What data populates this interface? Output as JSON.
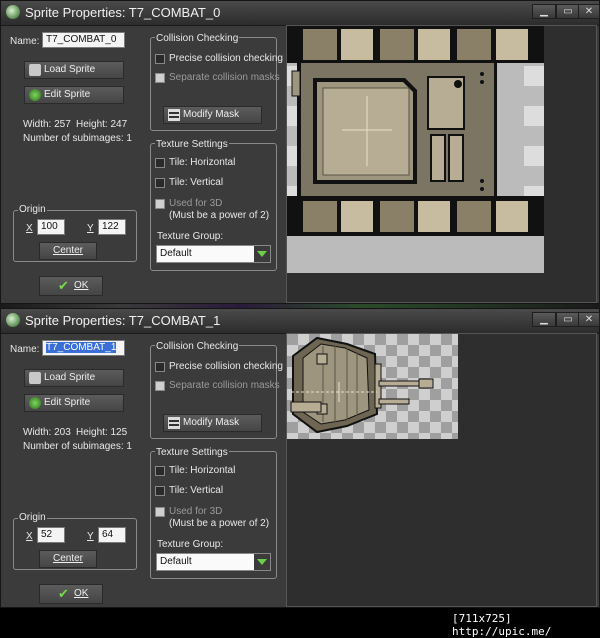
{
  "windows": [
    {
      "title": "Sprite Properties: T7_COMBAT_0",
      "name_label": "Name:",
      "name_value": "T7_COMBAT_0",
      "load_sprite": "Load Sprite",
      "edit_sprite": "Edit Sprite",
      "width_text": "Width: 257",
      "height_text": "Height: 247",
      "subimages_text": "Number of subimages: 1",
      "origin_label": "Origin",
      "x_label": "X",
      "x_value": "100",
      "y_label": "Y",
      "y_value": "122",
      "center": "Center",
      "ok": "OK",
      "collision_title": "Collision Checking",
      "precise": "Precise collision checking",
      "separate": "Separate collision masks",
      "modify_mask": "Modify Mask",
      "texture_title": "Texture Settings",
      "tile_h": "Tile: Horizontal",
      "tile_v": "Tile: Vertical",
      "used_3d": "Used for 3D",
      "power2": "(Must be a power of 2)",
      "texture_group_label": "Texture Group:",
      "texture_group_value": "Default"
    },
    {
      "title": "Sprite Properties: T7_COMBAT_1",
      "name_label": "Name:",
      "name_value": "T7_COMBAT_1",
      "load_sprite": "Load Sprite",
      "edit_sprite": "Edit Sprite",
      "width_text": "Width: 203",
      "height_text": "Height: 125",
      "subimages_text": "Number of subimages: 1",
      "origin_label": "Origin",
      "x_label": "X",
      "x_value": "52",
      "y_label": "Y",
      "y_value": "64",
      "center": "Center",
      "ok": "OK",
      "collision_title": "Collision Checking",
      "precise": "Precise collision checking",
      "separate": "Separate collision masks",
      "modify_mask": "Modify Mask",
      "texture_title": "Texture Settings",
      "tile_h": "Tile: Horizontal",
      "tile_v": "Tile: Vertical",
      "used_3d": "Used for 3D",
      "power2": "(Must be a power of 2)",
      "texture_group_label": "Texture Group:",
      "texture_group_value": "Default"
    }
  ],
  "footer": "[711x725] http://upic.me/",
  "colors": {
    "window_bg": "#3b3b3b",
    "accent_green": "#6ad04a",
    "selection": "#3a6fd8"
  },
  "icons": [
    "app-icon",
    "minimize-icon",
    "maximize-icon",
    "close-icon",
    "load-sprite-icon",
    "edit-sprite-icon",
    "mask-icon",
    "check-icon",
    "dropdown-arrow-icon"
  ]
}
